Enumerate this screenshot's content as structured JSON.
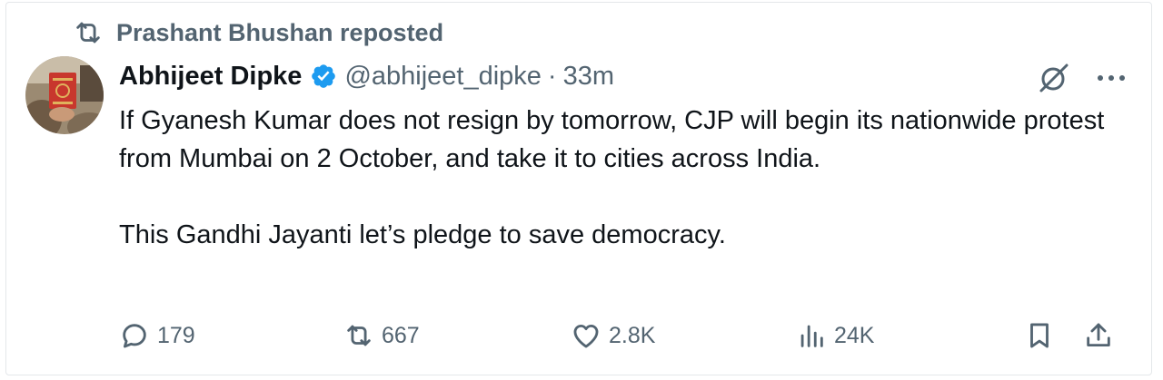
{
  "repost": {
    "icon": "repost-icon",
    "text": "Prashant Bhushan reposted"
  },
  "author": {
    "name": "Abhijeet Dipke",
    "verified_icon": "verified-badge-icon",
    "handle": "@abhijeet_dipke",
    "separator": "·",
    "time": "33m"
  },
  "top_icons": [
    "grok-icon",
    "more-icon"
  ],
  "content": {
    "paragraph1": "If Gyanesh Kumar does not resign by tomorrow, CJP will begin its nationwide protest from Mumbai on 2 October, and take it to cities across India.",
    "paragraph2": "This Gandhi Jayanti let’s pledge to save democracy."
  },
  "actions": {
    "replies": {
      "icon": "reply-icon",
      "count": "179"
    },
    "reposts": {
      "icon": "repost-icon",
      "count": "667"
    },
    "likes": {
      "icon": "heart-icon",
      "count": "2.8K"
    },
    "views": {
      "icon": "views-icon",
      "count": "24K"
    },
    "bookmark": {
      "icon": "bookmark-icon"
    },
    "share": {
      "icon": "share-icon"
    }
  },
  "colors": {
    "text": "#0f1419",
    "secondary": "#536471",
    "verified": "#1d9bf0",
    "border": "#e4e7ea"
  }
}
